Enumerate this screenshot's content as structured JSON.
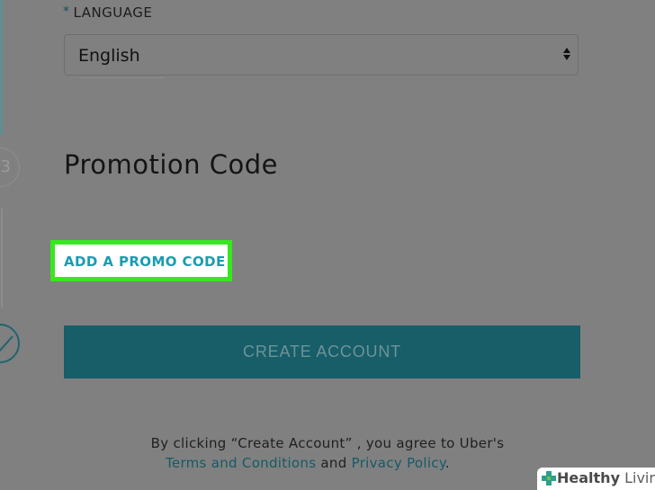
{
  "language": {
    "required_marker": "*",
    "label": "LANGUAGE",
    "selected": "English"
  },
  "steps": {
    "partial_number": "3"
  },
  "promotion": {
    "title": "Promotion Code",
    "add_link": "ADD A PROMO CODE"
  },
  "create_account": {
    "label": "CREATE ACCOUNT"
  },
  "terms": {
    "prefix": "By clicking “Create Account” , you agree to Uber's",
    "terms_link": "Terms and Conditions",
    "and": "and",
    "privacy_link": "Privacy Policy",
    "period": "."
  },
  "watermark": {
    "brand_bold": "Healthy",
    "brand_light": "Living"
  },
  "colors": {
    "overlay": "#808080",
    "highlight_border": "#35e81f",
    "link_accent": "#1a9cb0",
    "button_bg": "#175e69"
  }
}
